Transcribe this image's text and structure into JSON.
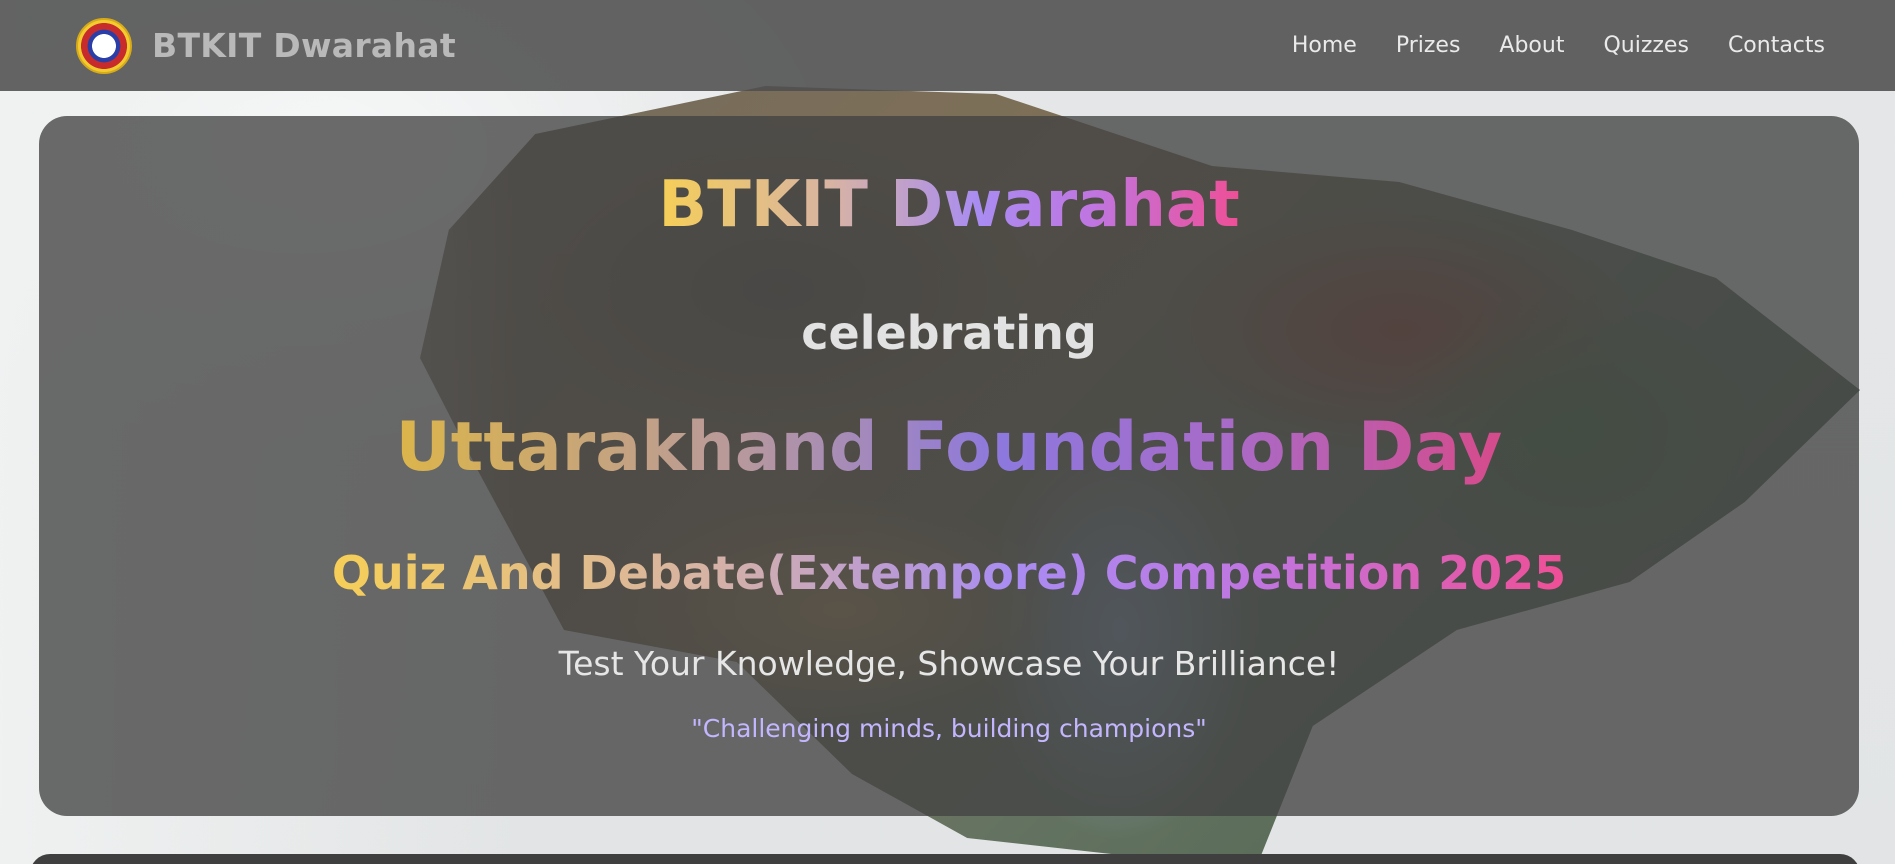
{
  "nav": {
    "brand": "BTKIT Dwarahat",
    "links": [
      "Home",
      "Prizes",
      "About",
      "Quizzes",
      "Contacts"
    ]
  },
  "hero": {
    "title": "BTKIT Dwarahat",
    "celebrating": "celebrating",
    "occasion": "Uttarakhand Foundation Day",
    "event": "Quiz And Debate(Extempore) Competition 2025",
    "tagline": "Test Your Knowledge, Showcase Your Brilliance!",
    "quote": "\"Challenging minds, building champions\""
  },
  "colors": {
    "gradient_start": "#f6cf57",
    "gradient_mid": "#a98cf2",
    "gradient_end": "#ef4f96",
    "quote": "#c3b6ff",
    "navbar": "#4e4e4e"
  },
  "icons": {
    "logo": "college-emblem-icon"
  }
}
